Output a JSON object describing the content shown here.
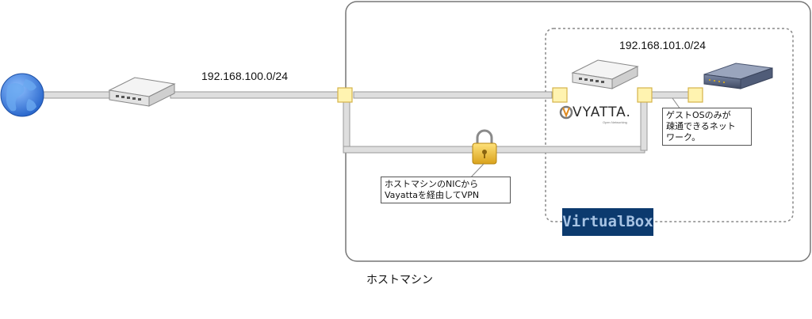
{
  "networks": {
    "outer": "192.168.100.0/24",
    "inner": "192.168.101.0/24"
  },
  "host": {
    "label": "ホストマシン"
  },
  "notes": {
    "vpn": [
      "ホストマシンのNICから",
      "Vayattaを経由してVPN"
    ],
    "guest": [
      "ゲストOSのみが",
      "疎通できるネット",
      "ワーク。"
    ]
  },
  "virtualbox": {
    "label": "VirtualBox"
  },
  "vyatta": {
    "logo": "VYATTA.",
    "tagline": "Open Networking"
  },
  "icons": [
    "globe-icon",
    "switch-icon",
    "router-icon",
    "server-icon",
    "lock-icon"
  ],
  "colors": {
    "pipe": "#d9d9d9",
    "pipe_edge": "#9a9a9a",
    "port": "#fff3b0",
    "port_edge": "#d4b34a",
    "globe": "#3b7fd8",
    "vbox_bg": "#0c3a6e"
  }
}
